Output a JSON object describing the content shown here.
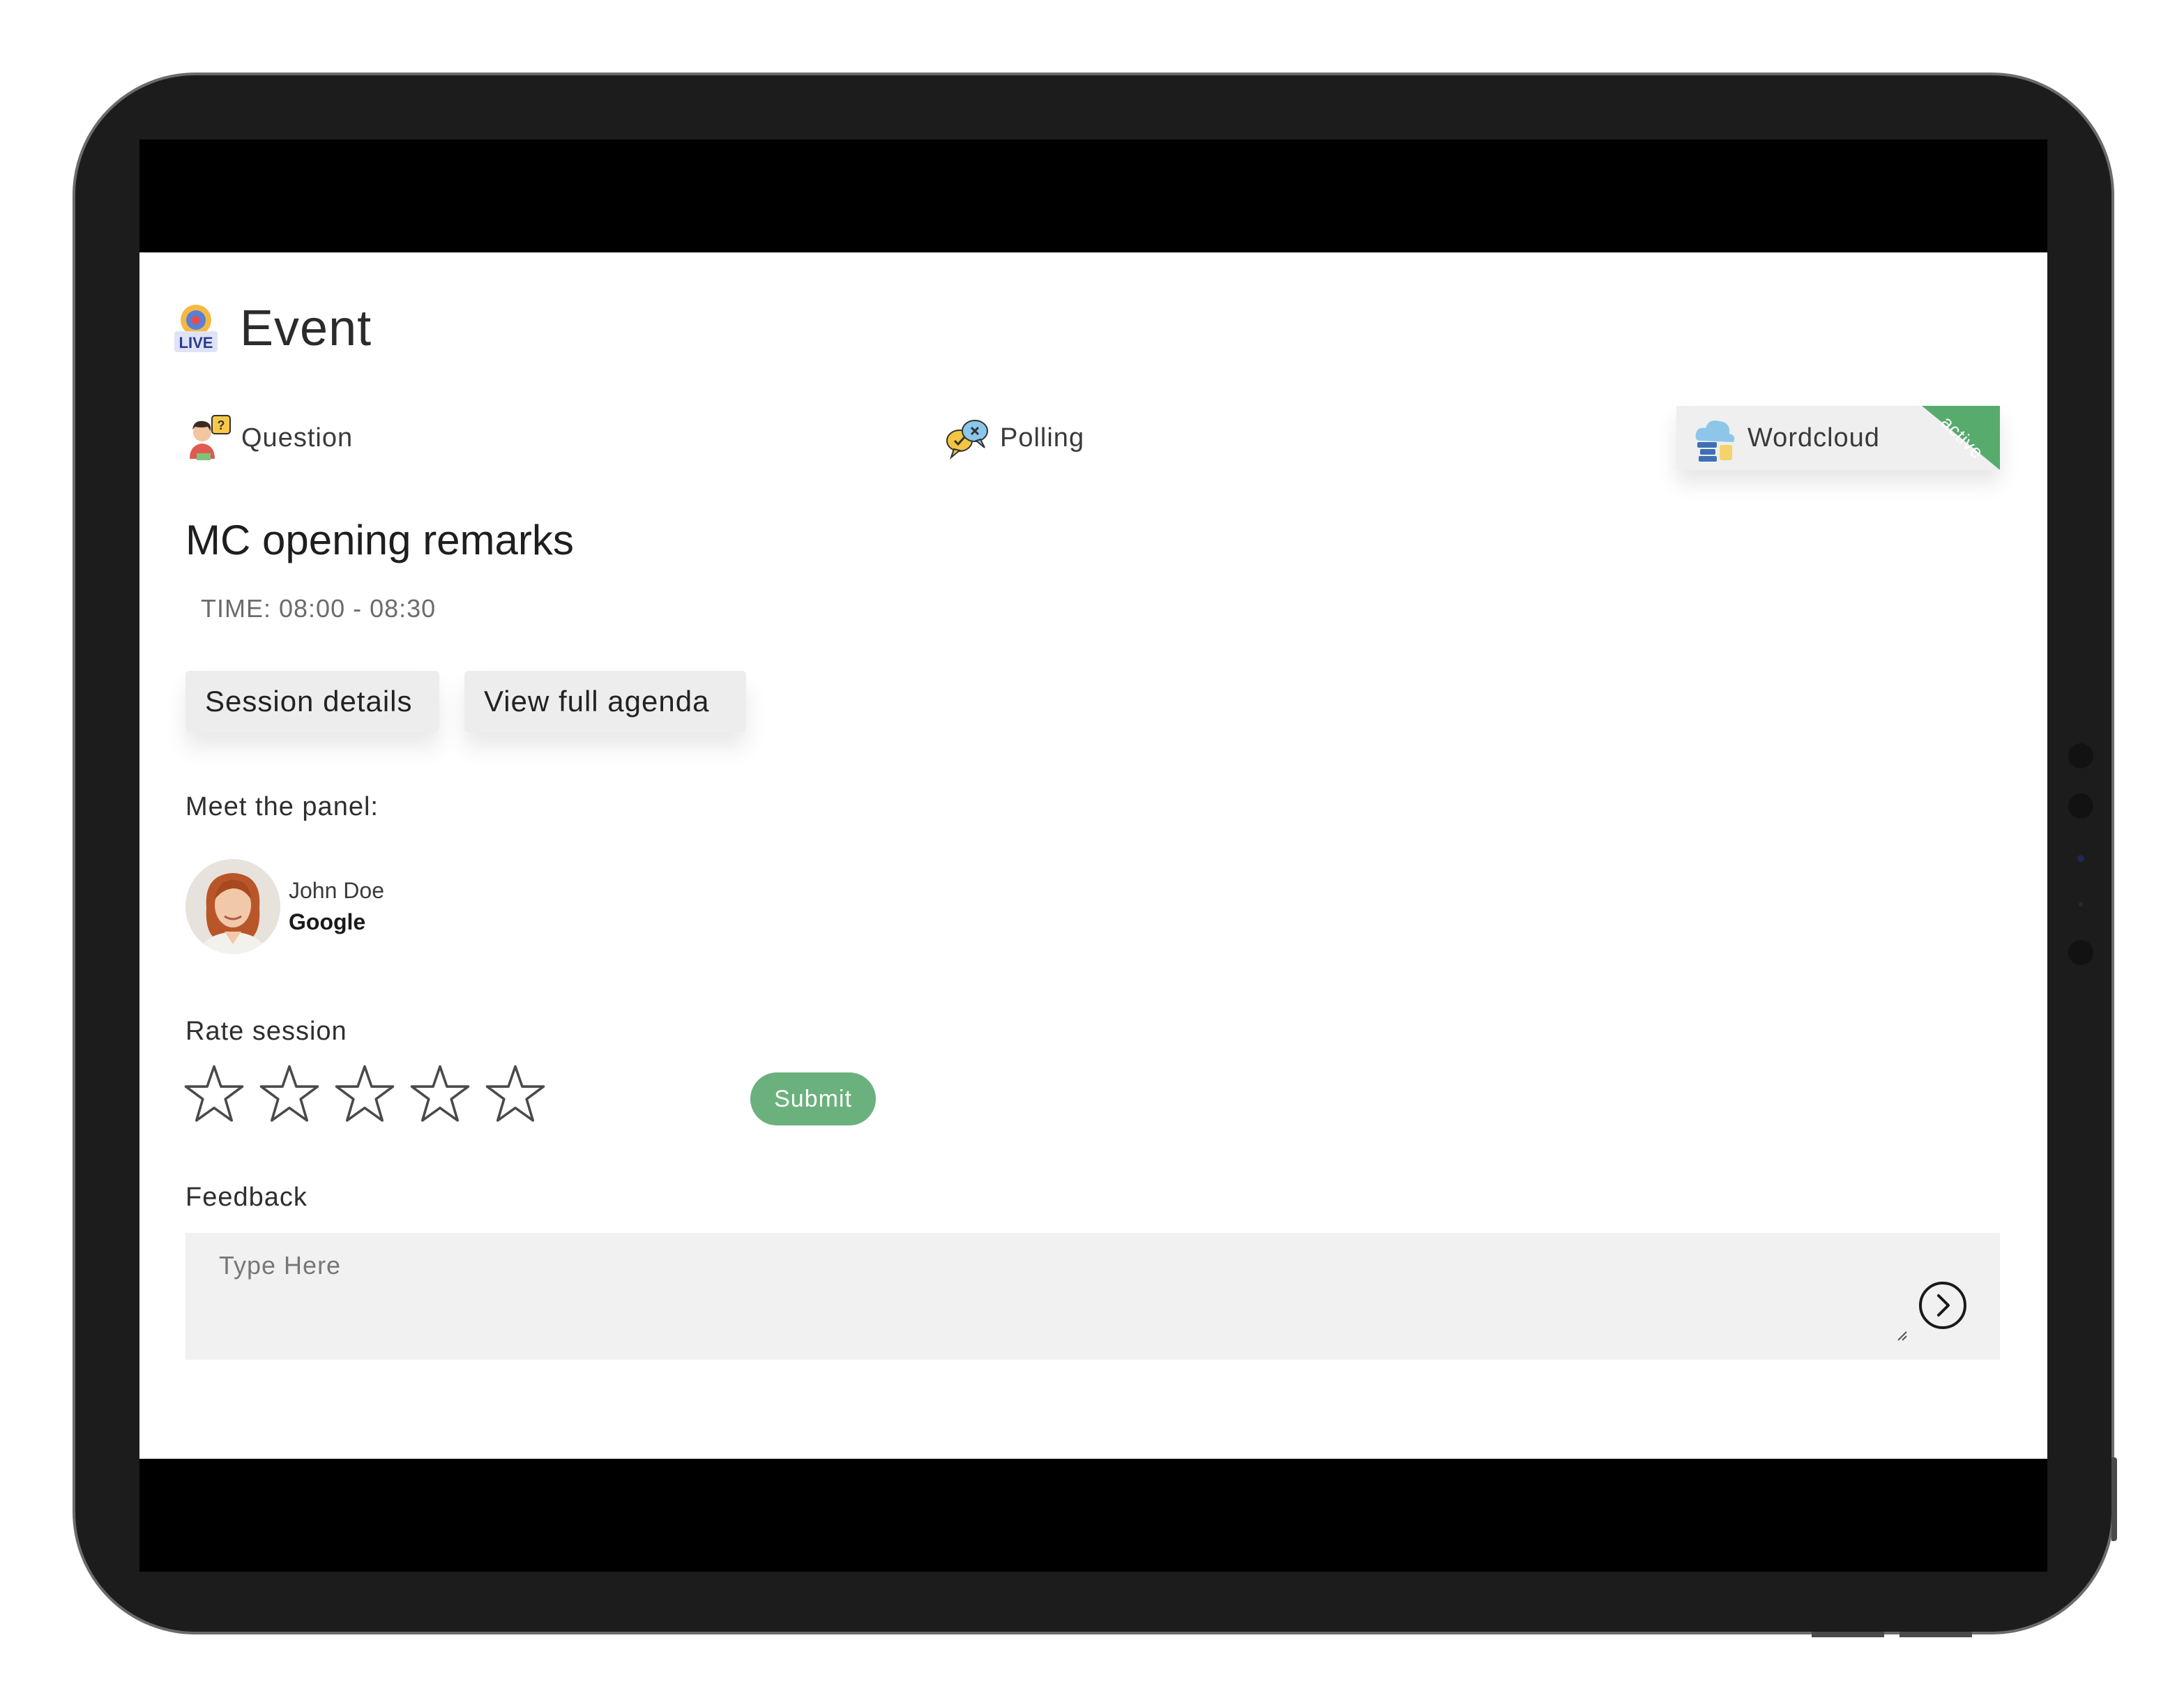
{
  "header": {
    "title": "Event",
    "live_badge": "LIVE",
    "icon": "live-broadcast-icon"
  },
  "tabs": [
    {
      "label": "Question",
      "icon": "question-person-icon",
      "active": false
    },
    {
      "label": "Polling",
      "icon": "polling-bubbles-icon",
      "active": false
    },
    {
      "label": "Wordcloud",
      "icon": "wordcloud-icon",
      "active": true,
      "badge": "active"
    }
  ],
  "session": {
    "title": "MC opening remarks",
    "time": "TIME: 08:00 - 08:30",
    "details_label": "Session details",
    "agenda_label": "View full agenda"
  },
  "panel": {
    "label": "Meet the panel:",
    "members": [
      {
        "name": "John Doe",
        "company": "Google"
      }
    ]
  },
  "rating": {
    "label": "Rate session",
    "max_stars": 5,
    "selected": 0,
    "submit_label": "Submit"
  },
  "feedback": {
    "label": "Feedback",
    "placeholder": "Type Here",
    "value": ""
  },
  "colors": {
    "accent_green": "#57ab6d",
    "submit_green": "#6bb17d",
    "frame": "#1c1c1d"
  }
}
